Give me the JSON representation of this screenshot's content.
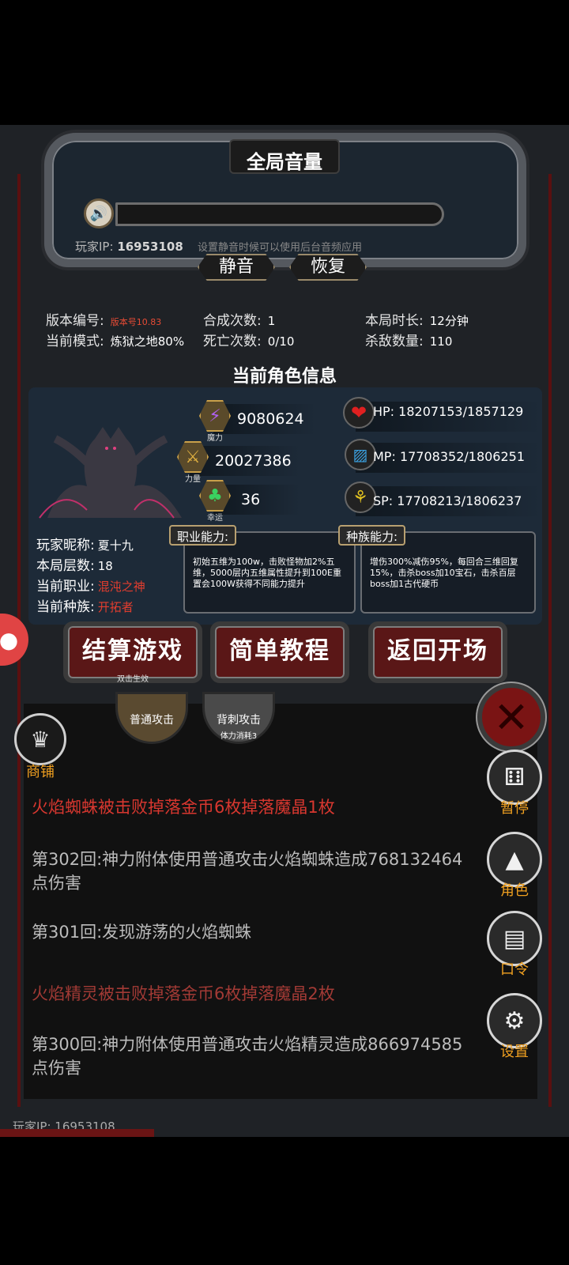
{
  "volume_panel": {
    "title": "全局音量",
    "ip_label": "玩家IP:",
    "ip_value": "16953108",
    "hint": "设置静音时候可以使用后台音频应用",
    "mute_label": "静音",
    "restore_label": "恢复"
  },
  "stats": {
    "version_label": "版本编号:",
    "version_value": "版本号10.83",
    "mode_label": "当前模式:",
    "mode_value": "炼狱之地80%",
    "synth_label": "合成次数:",
    "synth_value": "1",
    "death_label": "死亡次数:",
    "death_value": "0/10",
    "time_label": "本局时长:",
    "time_value": "12分钟",
    "kill_label": "杀敌数量:",
    "kill_value": "110"
  },
  "character": {
    "section_title": "当前角色信息",
    "magic_value": "9080624",
    "magic_caption": "魔力",
    "power_value": "20027386",
    "power_caption": "力量",
    "luck_value": "36",
    "luck_caption": "幸运",
    "hp_label": "HP:",
    "hp_value": "18207153/1857129",
    "mp_label": "MP:",
    "mp_value": "17708352/1806251",
    "sp_label": "SP:",
    "sp_value": "17708213/1806237",
    "nickname_label": "玩家昵称:",
    "nickname_value": "夏十九",
    "floor_label": "本局层数:",
    "floor_value": "18",
    "job_label": "当前职业:",
    "job_value": "混沌之神",
    "race_label": "当前种族:",
    "race_value": "开拓者",
    "job_ability_tag": "职业能力:",
    "job_ability_text": "初始五维为100w，击败怪物加2%五维，5000层内五维属性提升到100E重置会100W获得不同能力提升",
    "race_ability_tag": "种族能力:",
    "race_ability_text": "增伤300%减伤95%，每回合三维回复15%，击杀boss加10宝石，击杀百层boss加1古代硬币"
  },
  "buttons": {
    "settle_label": "结算游戏",
    "settle_sub": "双击生效",
    "tutorial_label": "简单教程",
    "return_label": "返回开场"
  },
  "skills": {
    "normal_attack": "普通攻击",
    "back_attack": "背刺攻击",
    "back_attack_sub": "体力消耗3"
  },
  "side": {
    "shop_label": "商铺",
    "pause_label": "暂停",
    "role_label": "角色",
    "code_label": "口令",
    "settings_label": "设置"
  },
  "log": [
    "火焰蜘蛛被击败掉落金币6枚掉落魔晶1枚",
    "第302回:神力附体使用普通攻击火焰蜘蛛造成768132464点伤害",
    "第301回:发现游荡的火焰蜘蛛",
    "火焰精灵被击败掉落金币6枚掉落魔晶2枚",
    "第300回:神力附体使用普通攻击火焰精灵造成866974585点伤害"
  ],
  "footer": {
    "ip_text": "玩家IP:  16953108"
  },
  "colors": {
    "accent_orange": "#f0a020",
    "log_red": "#d8372f",
    "button_red": "#5a1717"
  }
}
